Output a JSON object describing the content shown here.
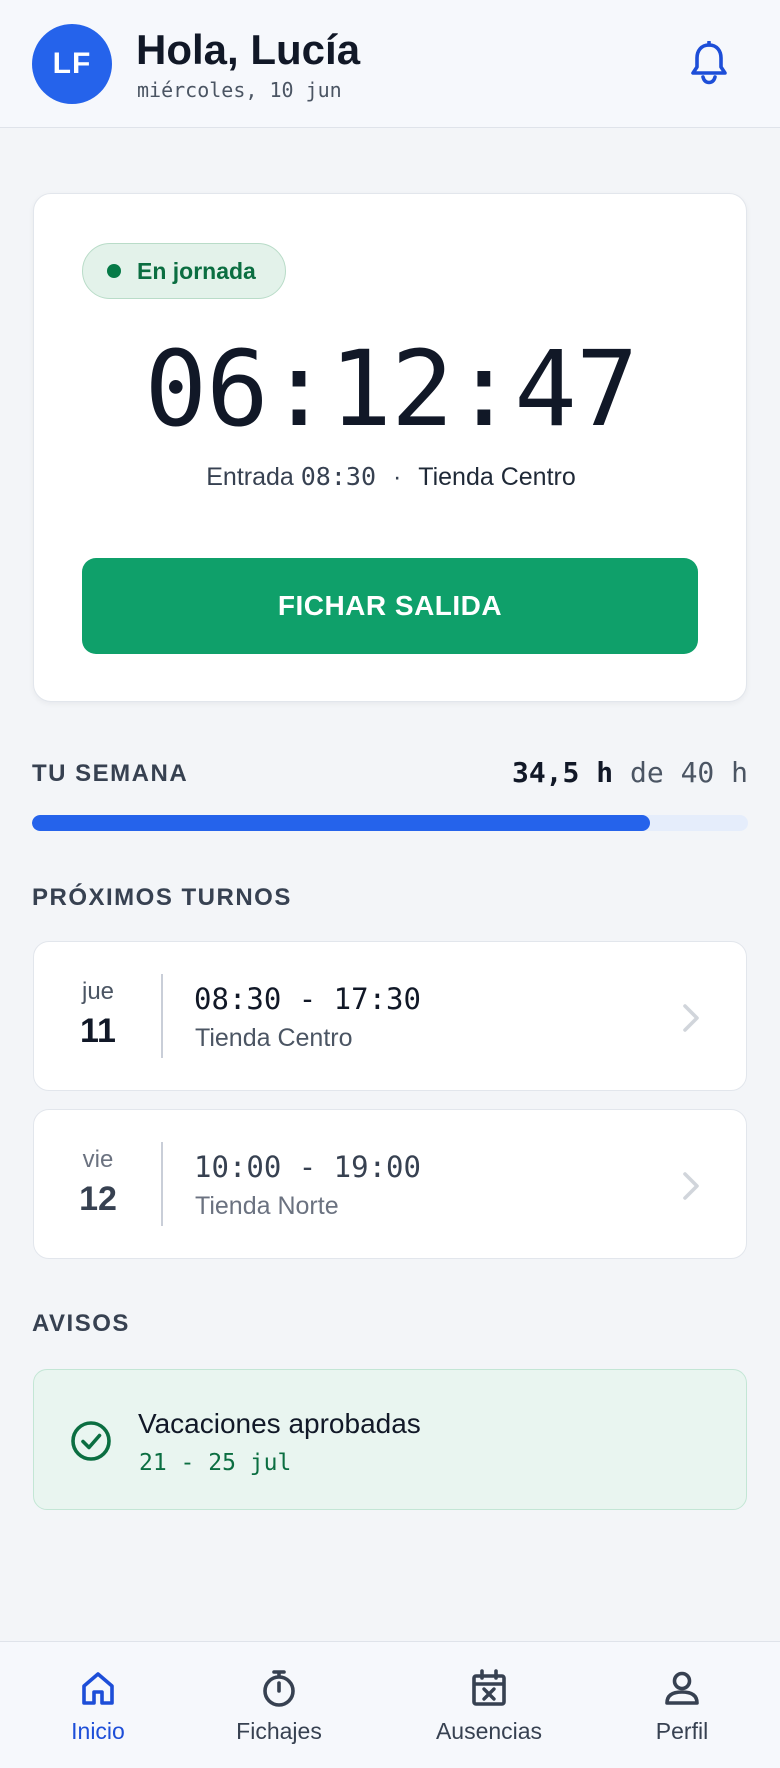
{
  "header": {
    "avatar_initials": "LF",
    "greeting": "Hola, Lucía",
    "date": "miércoles, 10 jun",
    "bell_icon": "bell-icon"
  },
  "clock": {
    "status": "En jornada",
    "elapsed": "06:12:47",
    "entry_label": "Entrada",
    "entry_time": "08:30",
    "separator": "·",
    "location": "Tienda Centro",
    "action_label": "FICHAR SALIDA"
  },
  "week": {
    "title": "TU SEMANA",
    "worked": "34,5 h",
    "of_label": "de",
    "target": "40 h",
    "progress_fraction": 0.8625
  },
  "shifts": {
    "title": "PRÓXIMOS TURNOS",
    "items": [
      {
        "dow": "jue",
        "day": "11",
        "time": "08:30 - 17:30",
        "place": "Tienda Centro"
      },
      {
        "dow": "vie",
        "day": "12",
        "time": "10:00 - 19:00",
        "place": "Tienda Norte"
      }
    ]
  },
  "notices": {
    "title": "AVISOS",
    "items": [
      {
        "title": "Vacaciones aprobadas",
        "detail": "21 - 25 jul",
        "icon": "check-circle-icon"
      }
    ]
  },
  "nav": {
    "items": [
      {
        "label": "Inicio",
        "icon": "home-icon",
        "active": true
      },
      {
        "label": "Fichajes",
        "icon": "stopwatch-icon",
        "active": false
      },
      {
        "label": "Ausencias",
        "icon": "calendar-x-icon",
        "active": false
      },
      {
        "label": "Perfil",
        "icon": "user-icon",
        "active": false
      }
    ]
  },
  "colors": {
    "primary": "#2563eb",
    "success": "#0fa06a",
    "success_dark": "#0b6e41",
    "text": "#111827"
  }
}
